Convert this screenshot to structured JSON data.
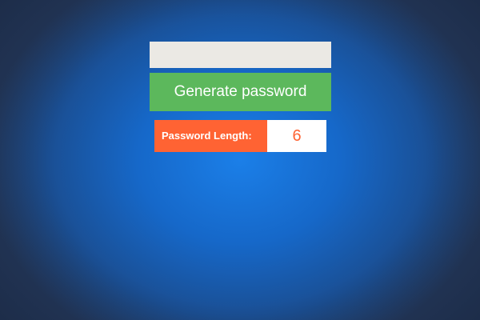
{
  "colors": {
    "background_center": "#1b7fe8",
    "background_edge": "#253a5e",
    "output_field": "#ebe9e4",
    "generate_button": "#5cb85c",
    "length_label_bg": "#ff6333",
    "length_value_text": "#ff6333"
  },
  "output": {
    "value": "",
    "placeholder": ""
  },
  "generate": {
    "label": "Generate password"
  },
  "length": {
    "label": "Password Length:",
    "value": "6"
  }
}
